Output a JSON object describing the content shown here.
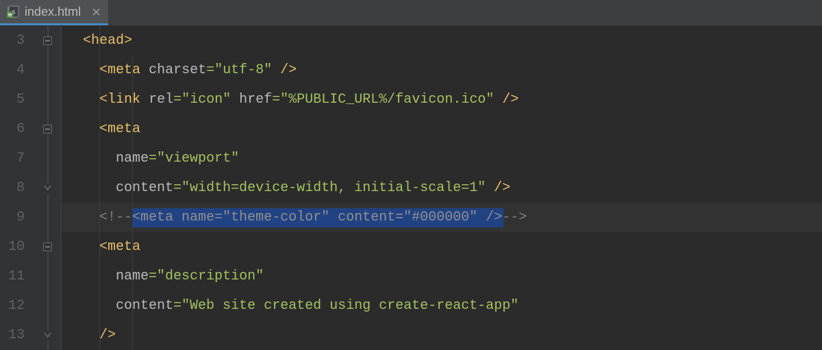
{
  "tab": {
    "label": "index.html"
  },
  "gutter": {
    "start": 3,
    "end": 13
  },
  "current_line": 9,
  "code": {
    "line3": {
      "indent": "  ",
      "open": "<",
      "tag": "head",
      "close": ">"
    },
    "line4": {
      "indent": "    ",
      "open": "<",
      "tag": "meta",
      "sp": " ",
      "attr": "charset",
      "eq": "=",
      "val": "\"utf-8\"",
      "close": " />"
    },
    "line5": {
      "indent": "    ",
      "open": "<",
      "tag": "link",
      "sp1": " ",
      "attr1": "rel",
      "eq1": "=",
      "val1": "\"icon\"",
      "sp2": " ",
      "attr2": "href",
      "eq2": "=",
      "val2": "\"%PUBLIC_URL%/favicon.ico\"",
      "close": " />"
    },
    "line6": {
      "indent": "    ",
      "open": "<",
      "tag": "meta"
    },
    "line7": {
      "indent": "      ",
      "attr": "name",
      "eq": "=",
      "val": "\"viewport\""
    },
    "line8": {
      "indent": "      ",
      "attr": "content",
      "eq": "=",
      "val": "\"width=device-width, initial-scale=1\"",
      "close": " />"
    },
    "line9": {
      "indent": "    ",
      "c_open": "<!--",
      "sel": "<meta name=\"theme-color\" content=\"#000000\" />",
      "c_close": "-->"
    },
    "line10": {
      "indent": "    ",
      "open": "<",
      "tag": "meta"
    },
    "line11": {
      "indent": "      ",
      "attr": "name",
      "eq": "=",
      "val": "\"description\""
    },
    "line12": {
      "indent": "      ",
      "attr": "content",
      "eq": "=",
      "val": "\"Web site created using create-react-app\""
    },
    "line13": {
      "indent": "    ",
      "close": "/>"
    }
  }
}
